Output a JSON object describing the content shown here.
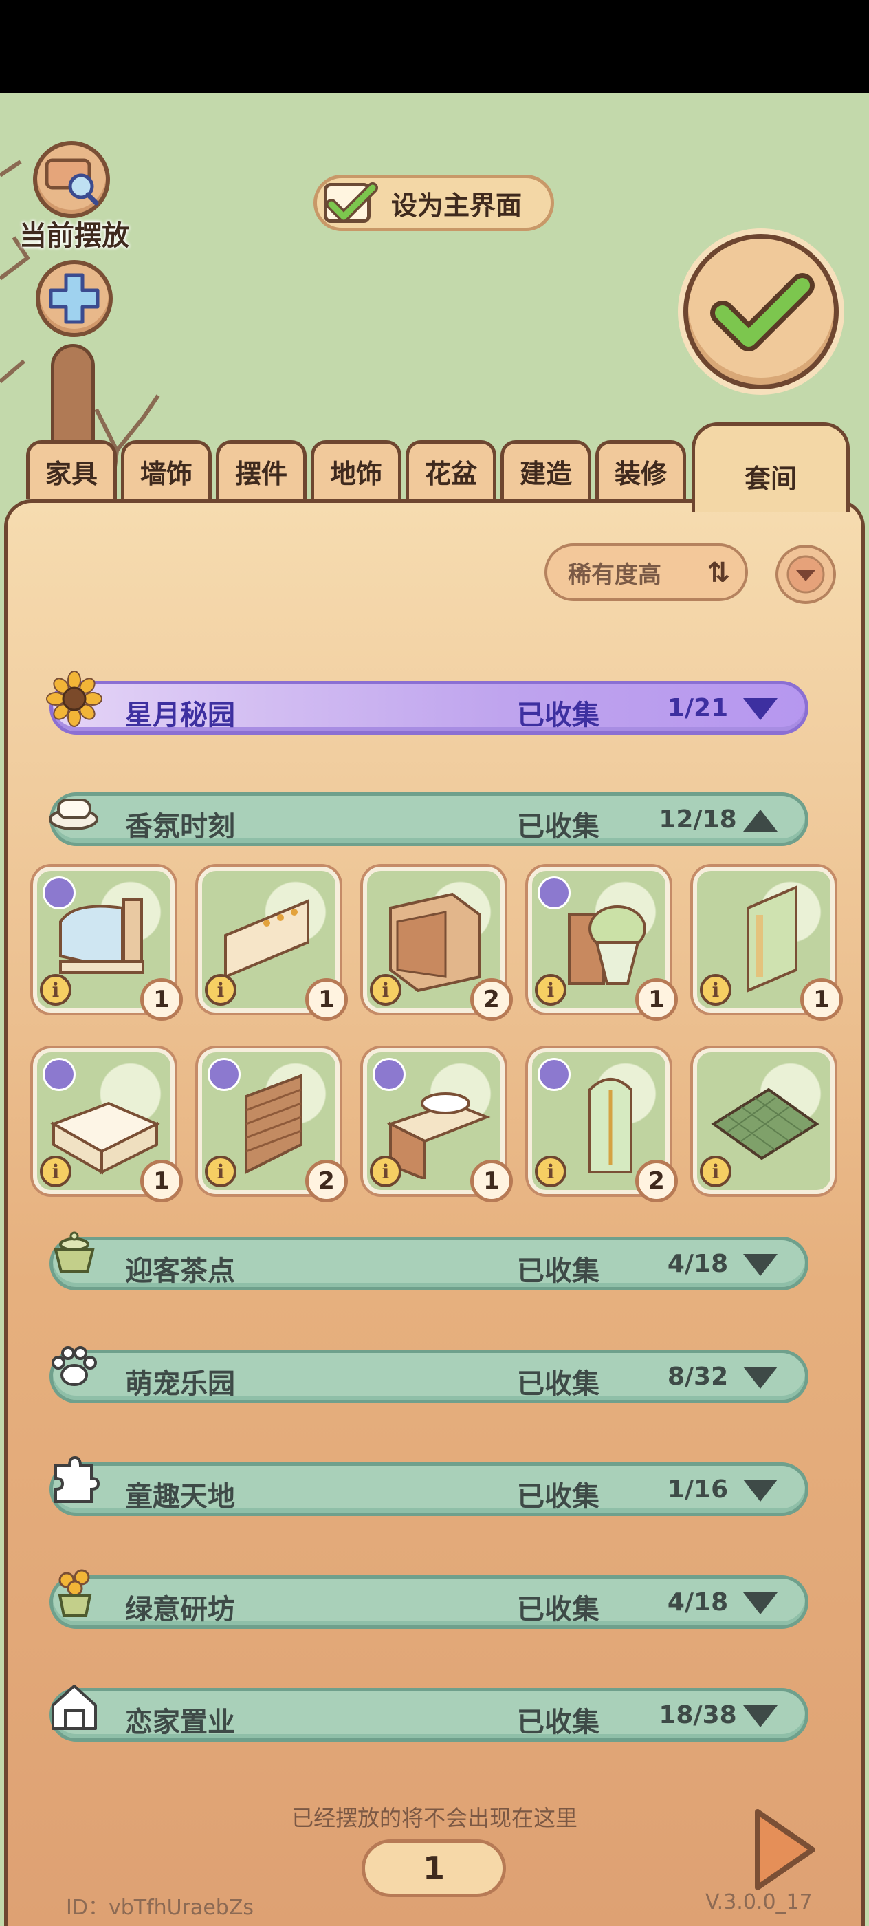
{
  "scene": {
    "current_placement_label": "当前摆放",
    "set_home_label": "设为主界面"
  },
  "tabs": [
    {
      "label": "家具"
    },
    {
      "label": "墙饰"
    },
    {
      "label": "摆件"
    },
    {
      "label": "地饰"
    },
    {
      "label": "花盆"
    },
    {
      "label": "建造"
    },
    {
      "label": "装修"
    },
    {
      "label": "套间",
      "active": true
    }
  ],
  "sort": {
    "label": "稀有度高"
  },
  "sets": [
    {
      "name": "星月秘园",
      "collected_label": "已收集",
      "count": "1/21",
      "expanded": false,
      "style": "purple",
      "icon": "sunflower-icon"
    },
    {
      "name": "香氛时刻",
      "collected_label": "已收集",
      "count": "12/18",
      "expanded": true,
      "style": "green",
      "icon": "soap-icon"
    },
    {
      "name": "迎客茶点",
      "collected_label": "已收集",
      "count": "4/18",
      "expanded": false,
      "style": "green",
      "icon": "teacup-icon"
    },
    {
      "name": "萌宠乐园",
      "collected_label": "已收集",
      "count": "8/32",
      "expanded": false,
      "style": "green",
      "icon": "paw-icon"
    },
    {
      "name": "童趣天地",
      "collected_label": "已收集",
      "count": "1/16",
      "expanded": false,
      "style": "green",
      "icon": "puzzle-icon"
    },
    {
      "name": "绿意研坊",
      "collected_label": "已收集",
      "count": "4/18",
      "expanded": false,
      "style": "green",
      "icon": "plant-icon"
    },
    {
      "name": "恋家置业",
      "collected_label": "已收集",
      "count": "18/38",
      "expanded": false,
      "style": "green",
      "icon": "house-icon"
    }
  ],
  "items": [
    {
      "icon": "mirror-cabinet-icon",
      "qty": "1",
      "badge": true
    },
    {
      "icon": "towel-rack-icon",
      "qty": "1",
      "badge": false
    },
    {
      "icon": "wooden-cabinet-icon",
      "qty": "2",
      "badge": false
    },
    {
      "icon": "toilet-icon",
      "qty": "1",
      "badge": true
    },
    {
      "icon": "tile-wall-icon",
      "qty": "1",
      "badge": false
    },
    {
      "icon": "bathtub-icon",
      "qty": "1",
      "badge": true
    },
    {
      "icon": "blinds-icon",
      "qty": "2",
      "badge": true
    },
    {
      "icon": "vanity-sink-icon",
      "qty": "1",
      "badge": true
    },
    {
      "icon": "shower-icon",
      "qty": "2",
      "badge": true
    },
    {
      "icon": "floor-tile-icon",
      "qty": "",
      "badge": false
    }
  ],
  "footer": {
    "note": "已经摆放的将不会出现在这里",
    "page": "1",
    "id": "ID：vbTfhUraebZs",
    "version": "V.3.0.0_17"
  },
  "colors": {
    "background": "#c3d9ab",
    "panel": "#f6dcb0",
    "set_row_green": "#a9d0b9",
    "set_row_purple": "#bfa4ee",
    "outline": "#6e4630"
  }
}
